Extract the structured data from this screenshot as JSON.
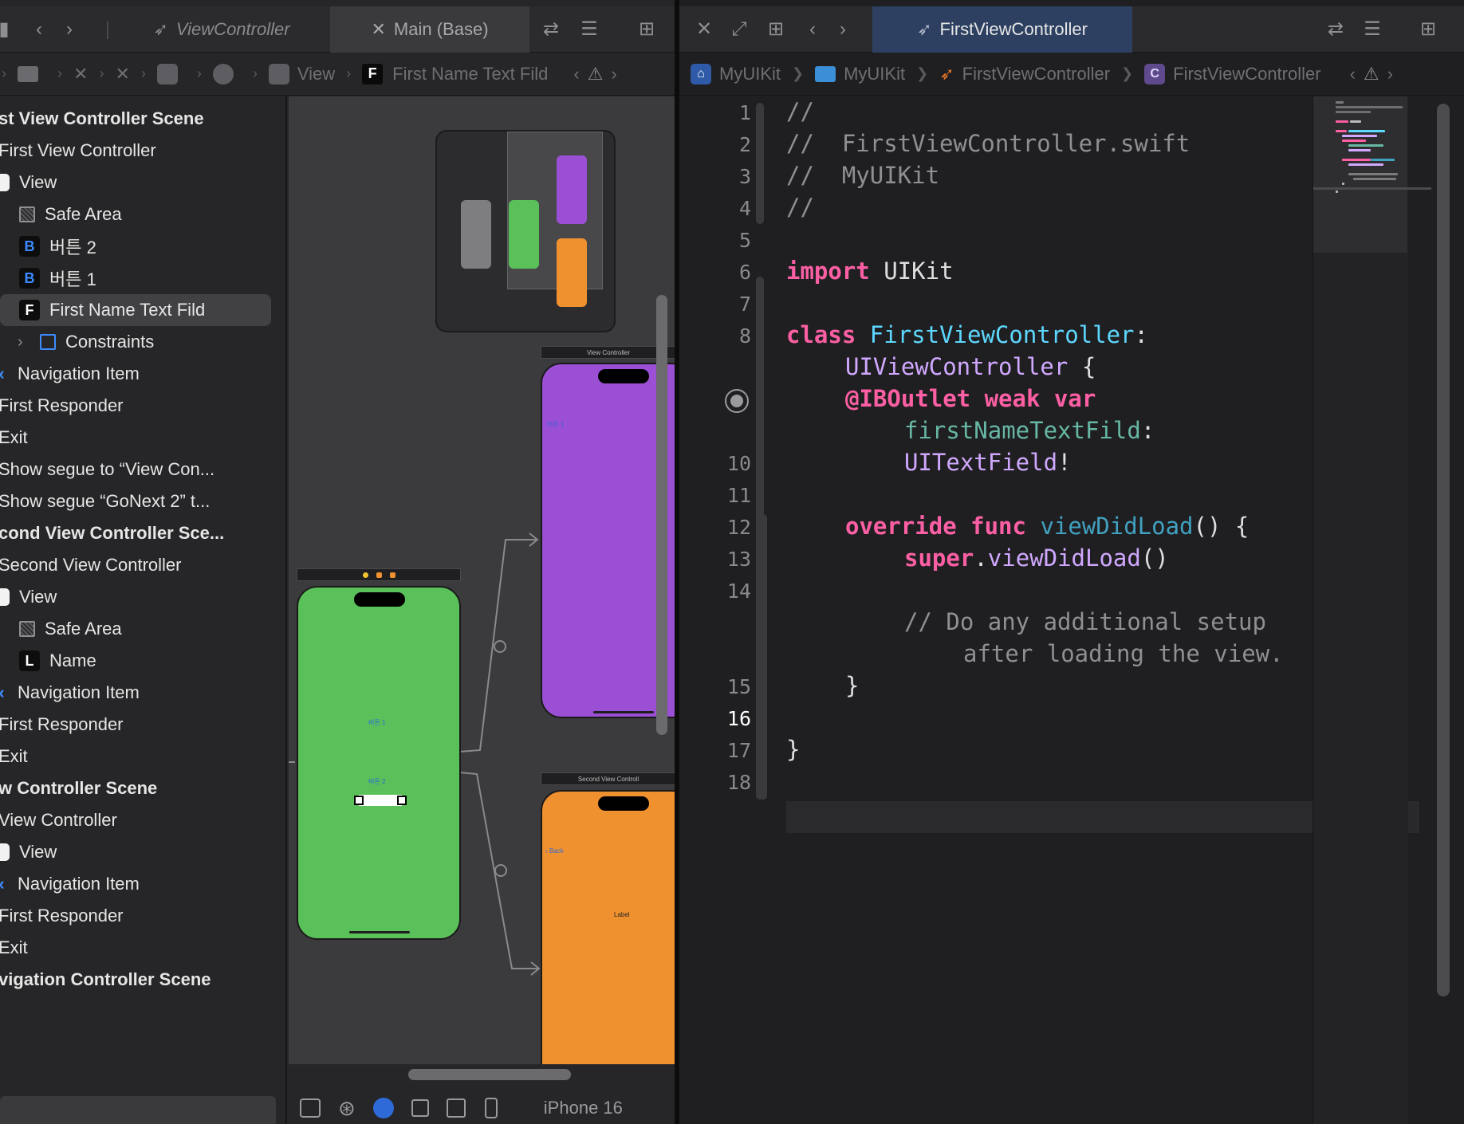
{
  "left_tabbar": {
    "tab1": "ViewController",
    "tab2": "Main (Base)"
  },
  "left_jumpbar": {
    "crumb_view": "View",
    "crumb_field": "First Name Text Fild",
    "field_badge": "F"
  },
  "outline": [
    {
      "label": "st View Controller Scene",
      "bold": true
    },
    {
      "label": "First View Controller"
    },
    {
      "label": "View",
      "icon": "view"
    },
    {
      "label": "Safe Area",
      "icon": "safe"
    },
    {
      "label": "버튼 2",
      "icon": "B"
    },
    {
      "label": "버튼 1",
      "icon": "B"
    },
    {
      "label": "First Name Text Fild",
      "icon": "F",
      "selected": true
    },
    {
      "label": "Constraints",
      "icon": "cons"
    },
    {
      "label": "Navigation Item",
      "icon": "nav"
    },
    {
      "label": "First Responder"
    },
    {
      "label": "Exit"
    },
    {
      "label": "Show segue to “View Con..."
    },
    {
      "label": "Show segue “GoNext 2” t..."
    },
    {
      "label": "cond View Controller Sce...",
      "bold": true
    },
    {
      "label": "Second View Controller"
    },
    {
      "label": "View",
      "icon": "view"
    },
    {
      "label": "Safe Area",
      "icon": "safe"
    },
    {
      "label": "Name",
      "icon": "L"
    },
    {
      "label": "Navigation Item",
      "icon": "nav"
    },
    {
      "label": "First Responder"
    },
    {
      "label": "Exit"
    },
    {
      "label": "w Controller Scene",
      "bold": true
    },
    {
      "label": "View Controller"
    },
    {
      "label": "View",
      "icon": "view"
    },
    {
      "label": "Navigation Item",
      "icon": "nav"
    },
    {
      "label": "First Responder"
    },
    {
      "label": "Exit"
    },
    {
      "label": "vigation Controller Scene",
      "bold": true
    }
  ],
  "canvas": {
    "scene_title_purple": "View Controller",
    "scene_title_orange": "Second View Controll",
    "green_button1": "버튼 1",
    "green_button2": "버튼 2",
    "purple_label": "버튼 1",
    "orange_back": "Back",
    "orange_label": "Label",
    "colors": {
      "green": "#5ac05a",
      "purple": "#9b4fd4",
      "orange": "#f0912f"
    }
  },
  "device_label": "iPhone 16",
  "right_tab": "FirstViewController",
  "right_jumpbar": {
    "project": "MyUIKit",
    "group": "MyUIKit",
    "file": "FirstViewController",
    "symbol": "FirstViewController",
    "symbol_badge": "C"
  },
  "line_numbers": [
    "1",
    "2",
    "3",
    "4",
    "5",
    "6",
    "7",
    "8",
    "",
    "10",
    "11",
    "12",
    "13",
    "14",
    "15",
    "16",
    "17",
    "18"
  ],
  "current_line": "16",
  "code": {
    "l1": "//",
    "l2": "//  FirstViewController.swift",
    "l3": "//  MyUIKit",
    "l4": "//",
    "l6_kw": "import",
    "l6_mod": " UIKit",
    "l8_kw": "class",
    "l8_name": " FirstViewController",
    "l8_colon": ":",
    "l9_super": "UIViewController",
    "l9_brace": " {",
    "l10_attr": "@IBOutlet",
    "l10_kw": " weak var",
    "l11_name": "firstNameTextFild",
    "l11_colon": ":",
    "l12_type": "UITextField",
    "l12_bang": "!",
    "l14_kw": "override func",
    "l14_fn": " viewDidLoad",
    "l14_rest": "() {",
    "l15_kw": "super",
    "l15_dot": ".",
    "l15_fn": "viewDidLoad",
    "l15_rest": "()",
    "l17_comment": "// Do any additional setup",
    "l18_comment": "after loading the view.",
    "l19_close": "}",
    "l21_close": "}"
  }
}
